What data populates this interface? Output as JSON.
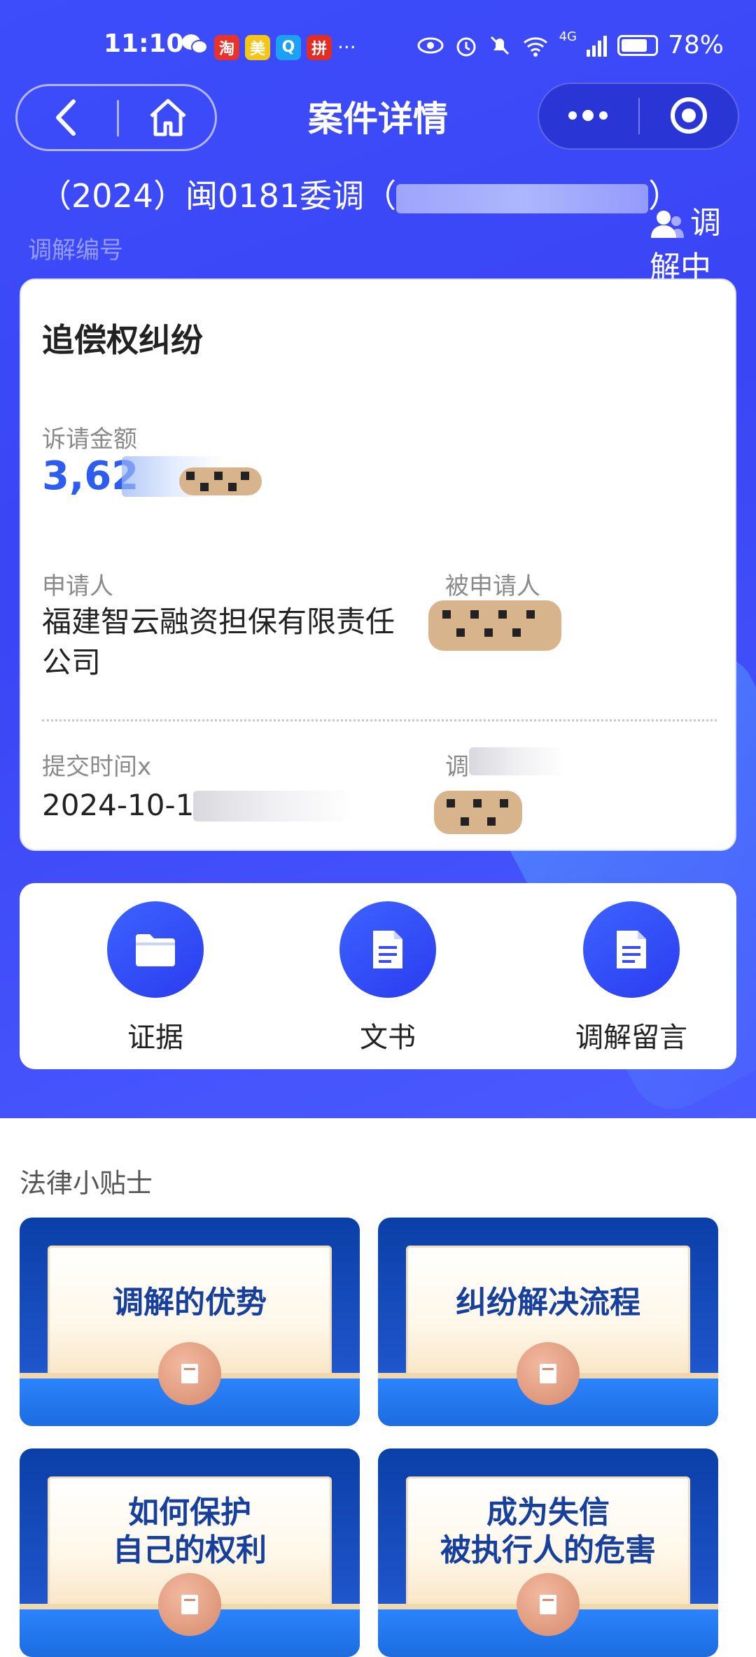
{
  "status_bar": {
    "time": "11:10",
    "dots": "···",
    "network": "4G",
    "battery": "78%",
    "app_icons": [
      {
        "name": "taobao-icon",
        "char": "淘",
        "color": "#e8332a"
      },
      {
        "name": "meituan-icon",
        "char": "美",
        "color": "#f5c518"
      },
      {
        "name": "qq-browser-icon",
        "char": "Q",
        "color": "#1da1f2"
      },
      {
        "name": "pinduoduo-icon",
        "char": "拼",
        "color": "#e02e24"
      }
    ]
  },
  "nav": {
    "title": "案件详情"
  },
  "case": {
    "number": "（2024）闽0181委调（",
    "number_suffix": "）",
    "number_caption": "调解编号",
    "status": "调解中"
  },
  "card": {
    "title": "追偿权纠纷",
    "amount_label": "诉请金额",
    "amount_value": "3,62",
    "applicant_label": "申请人",
    "applicant_value": "福建智云融资担保有限责任公司",
    "respondent_label": "被申请人",
    "submit_label": "提交时间x",
    "submit_value": "2024-10-1",
    "mediator_label": "调"
  },
  "actions": [
    {
      "label": "证据",
      "icon": "folder-icon"
    },
    {
      "label": "文书",
      "icon": "document-icon"
    },
    {
      "label": "调解留言",
      "icon": "document-icon"
    }
  ],
  "tips": {
    "title": "法律小贴士",
    "items": [
      {
        "line1": "调解的优势",
        "line2": ""
      },
      {
        "line1": "纠纷解决流程",
        "line2": ""
      },
      {
        "line1": "如何保护",
        "line2": "自己的权利"
      },
      {
        "line1": "成为失信",
        "line2": "被执行人的危害"
      }
    ]
  }
}
